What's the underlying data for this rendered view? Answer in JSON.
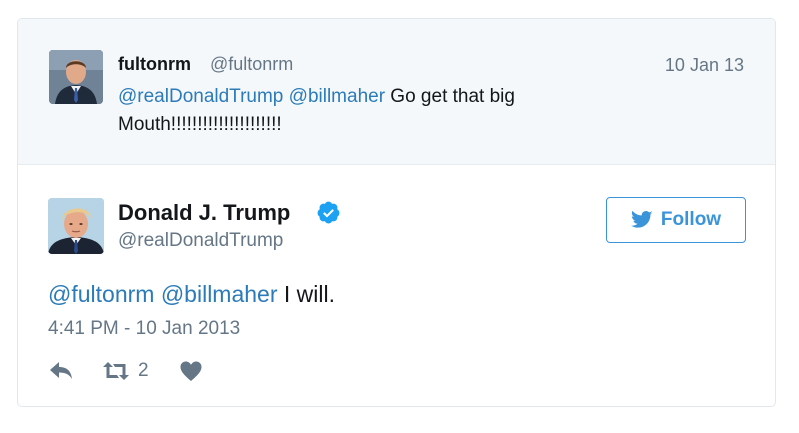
{
  "parent_tweet": {
    "display_name": "fultonrm",
    "handle": "@fultonrm",
    "date": "10 Jan 13",
    "mention_1": "@realDonaldTrump",
    "mention_2": "@billmaher",
    "text": " Go get that big Mouth!!!!!!!!!!!!!!!!!!!!!"
  },
  "main_tweet": {
    "display_name": "Donald J. Trump",
    "handle": "@realDonaldTrump",
    "mention_1": "@fultonrm",
    "mention_2": "@billmaher",
    "text": " I will.",
    "timestamp": "4:41 PM - 10 Jan 2013",
    "verified": true
  },
  "follow_button": {
    "label": "Follow"
  },
  "actions": {
    "reply_icon": "reply-icon",
    "retweet_icon": "retweet-icon",
    "retweet_count": "2",
    "like_icon": "heart-icon"
  },
  "colors": {
    "link": "#2b7bb9",
    "accent": "#3b94d9",
    "muted": "#657786",
    "parent_bg": "#f5f8fa",
    "border": "#e1e8ed"
  }
}
